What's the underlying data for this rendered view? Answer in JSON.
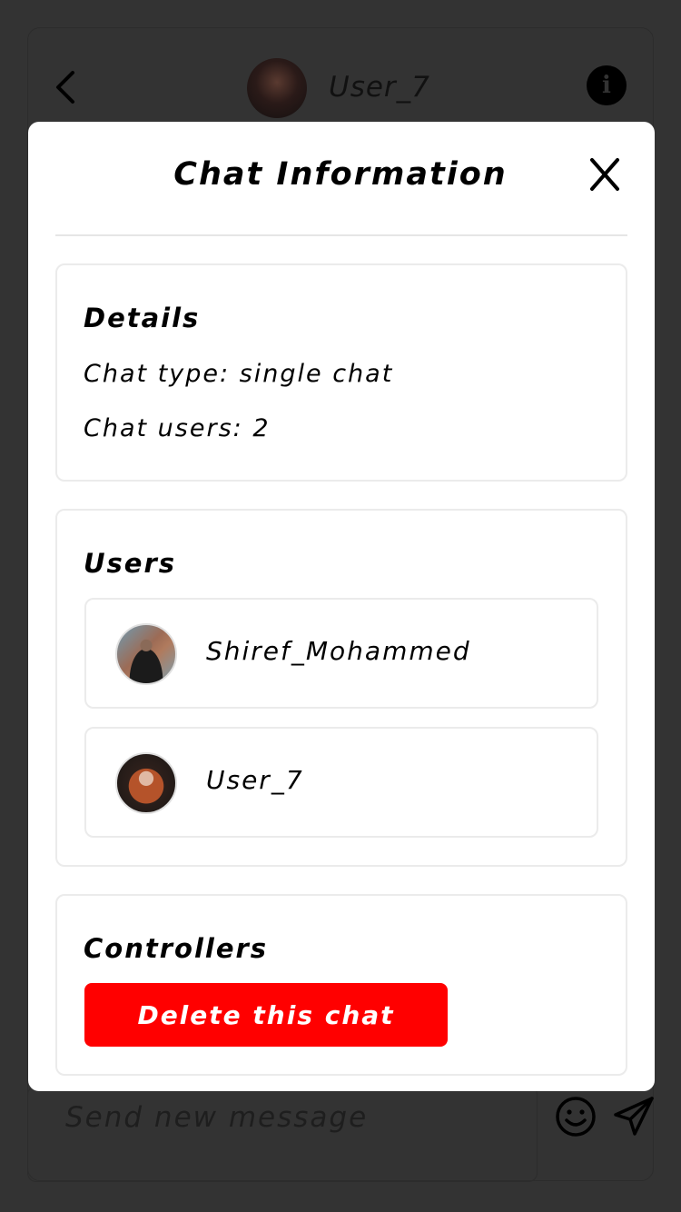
{
  "header": {
    "username": "User_7",
    "back_icon": "chevron-left-icon",
    "info_icon": "info-icon",
    "info_glyph": "i"
  },
  "composer": {
    "placeholder": "Send new message",
    "emoji_icon": "smiley-icon",
    "send_icon": "paper-plane-icon"
  },
  "modal": {
    "title": "Chat Information",
    "close_icon": "close-icon",
    "details": {
      "title": "Details",
      "chat_type": "Chat type: single chat",
      "chat_users": "Chat users: 2"
    },
    "users": {
      "title": "Users",
      "list": [
        {
          "name": "Shiref_Mohammed"
        },
        {
          "name": "User_7"
        }
      ]
    },
    "controllers": {
      "title": "Controllers",
      "delete_label": "Delete this chat"
    }
  },
  "colors": {
    "overlay": "#333333",
    "modal_bg": "#ffffff",
    "danger": "#ff0000",
    "border": "#ebebeb"
  }
}
